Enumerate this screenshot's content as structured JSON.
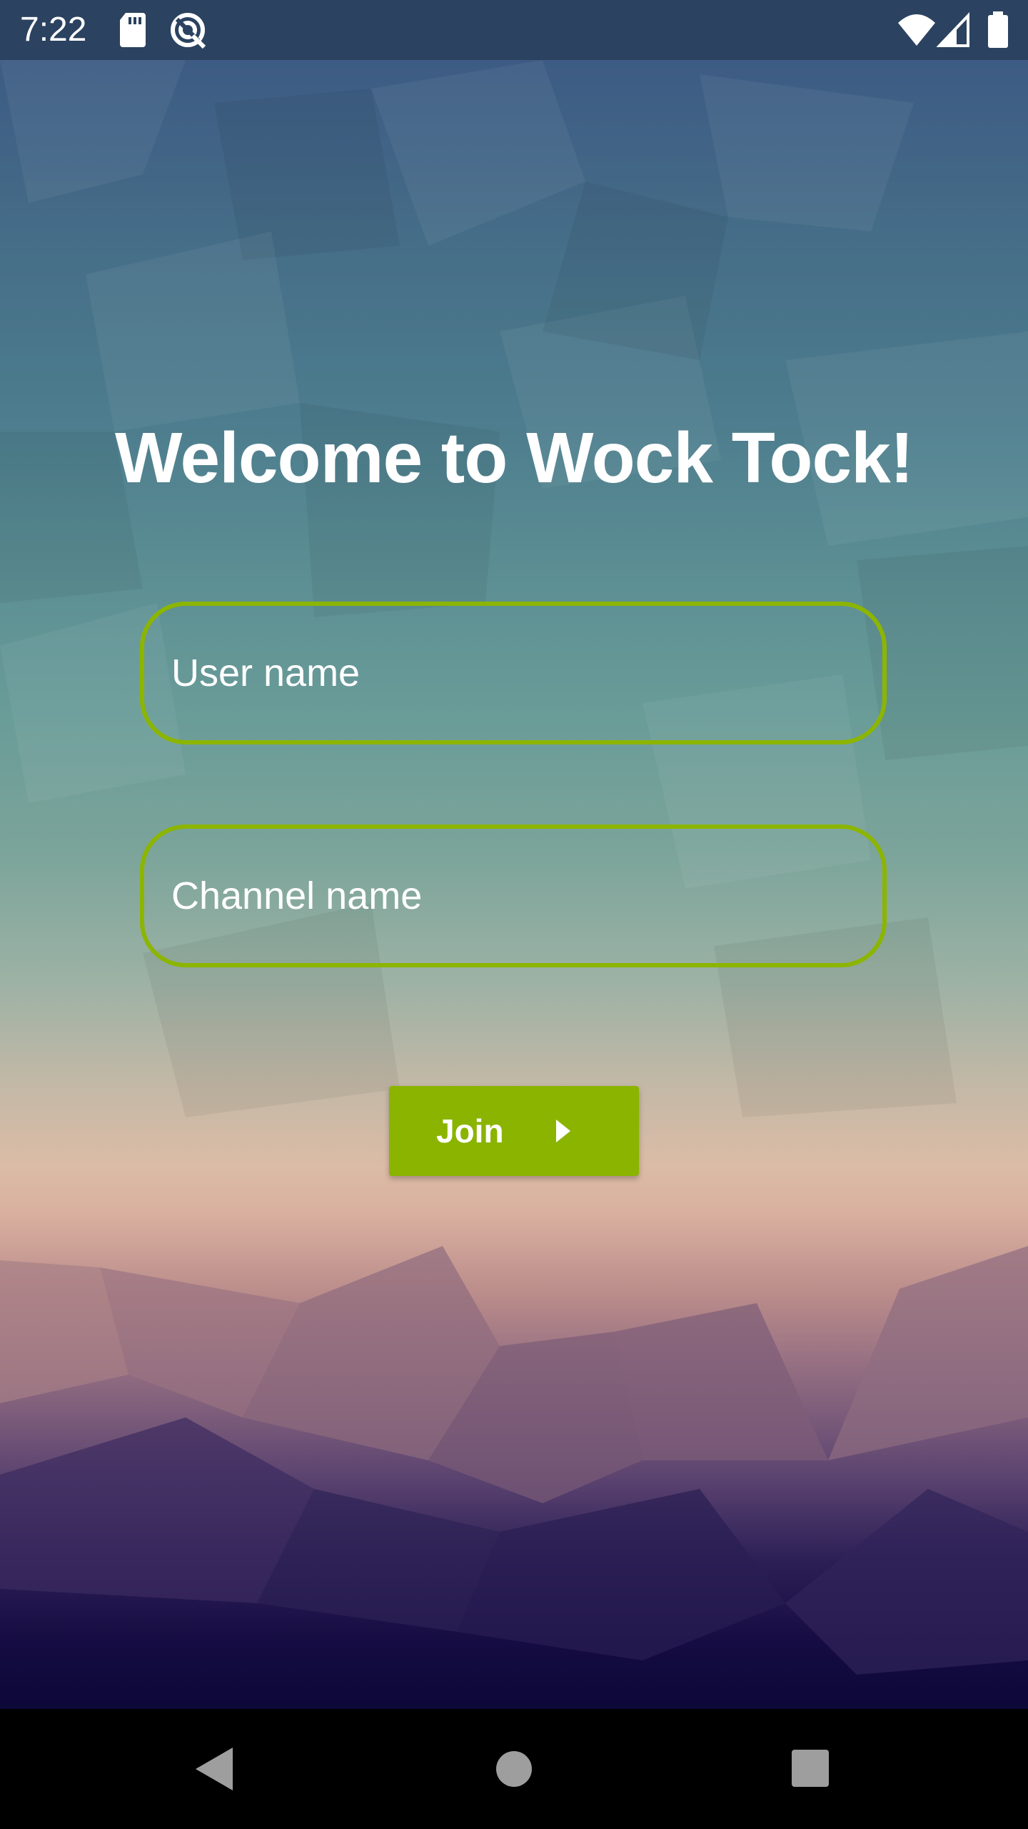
{
  "status_bar": {
    "time": "7:22",
    "icons": [
      "sd-card-icon",
      "sync-icon",
      "wifi-icon",
      "cell-signal-icon",
      "battery-icon"
    ]
  },
  "main": {
    "title": "Welcome to Wock Tock!",
    "user_field": {
      "placeholder": "User name",
      "value": ""
    },
    "channel_field": {
      "placeholder": "Channel name",
      "value": ""
    },
    "join_button": {
      "label": "Join",
      "icon": "play-arrow-icon"
    }
  },
  "colors": {
    "accent": "#8ab400",
    "status_bar_bg": "#2b4260",
    "text": "#ffffff"
  },
  "nav_bar": {
    "icons": [
      "back-icon",
      "home-icon",
      "recents-icon"
    ]
  }
}
